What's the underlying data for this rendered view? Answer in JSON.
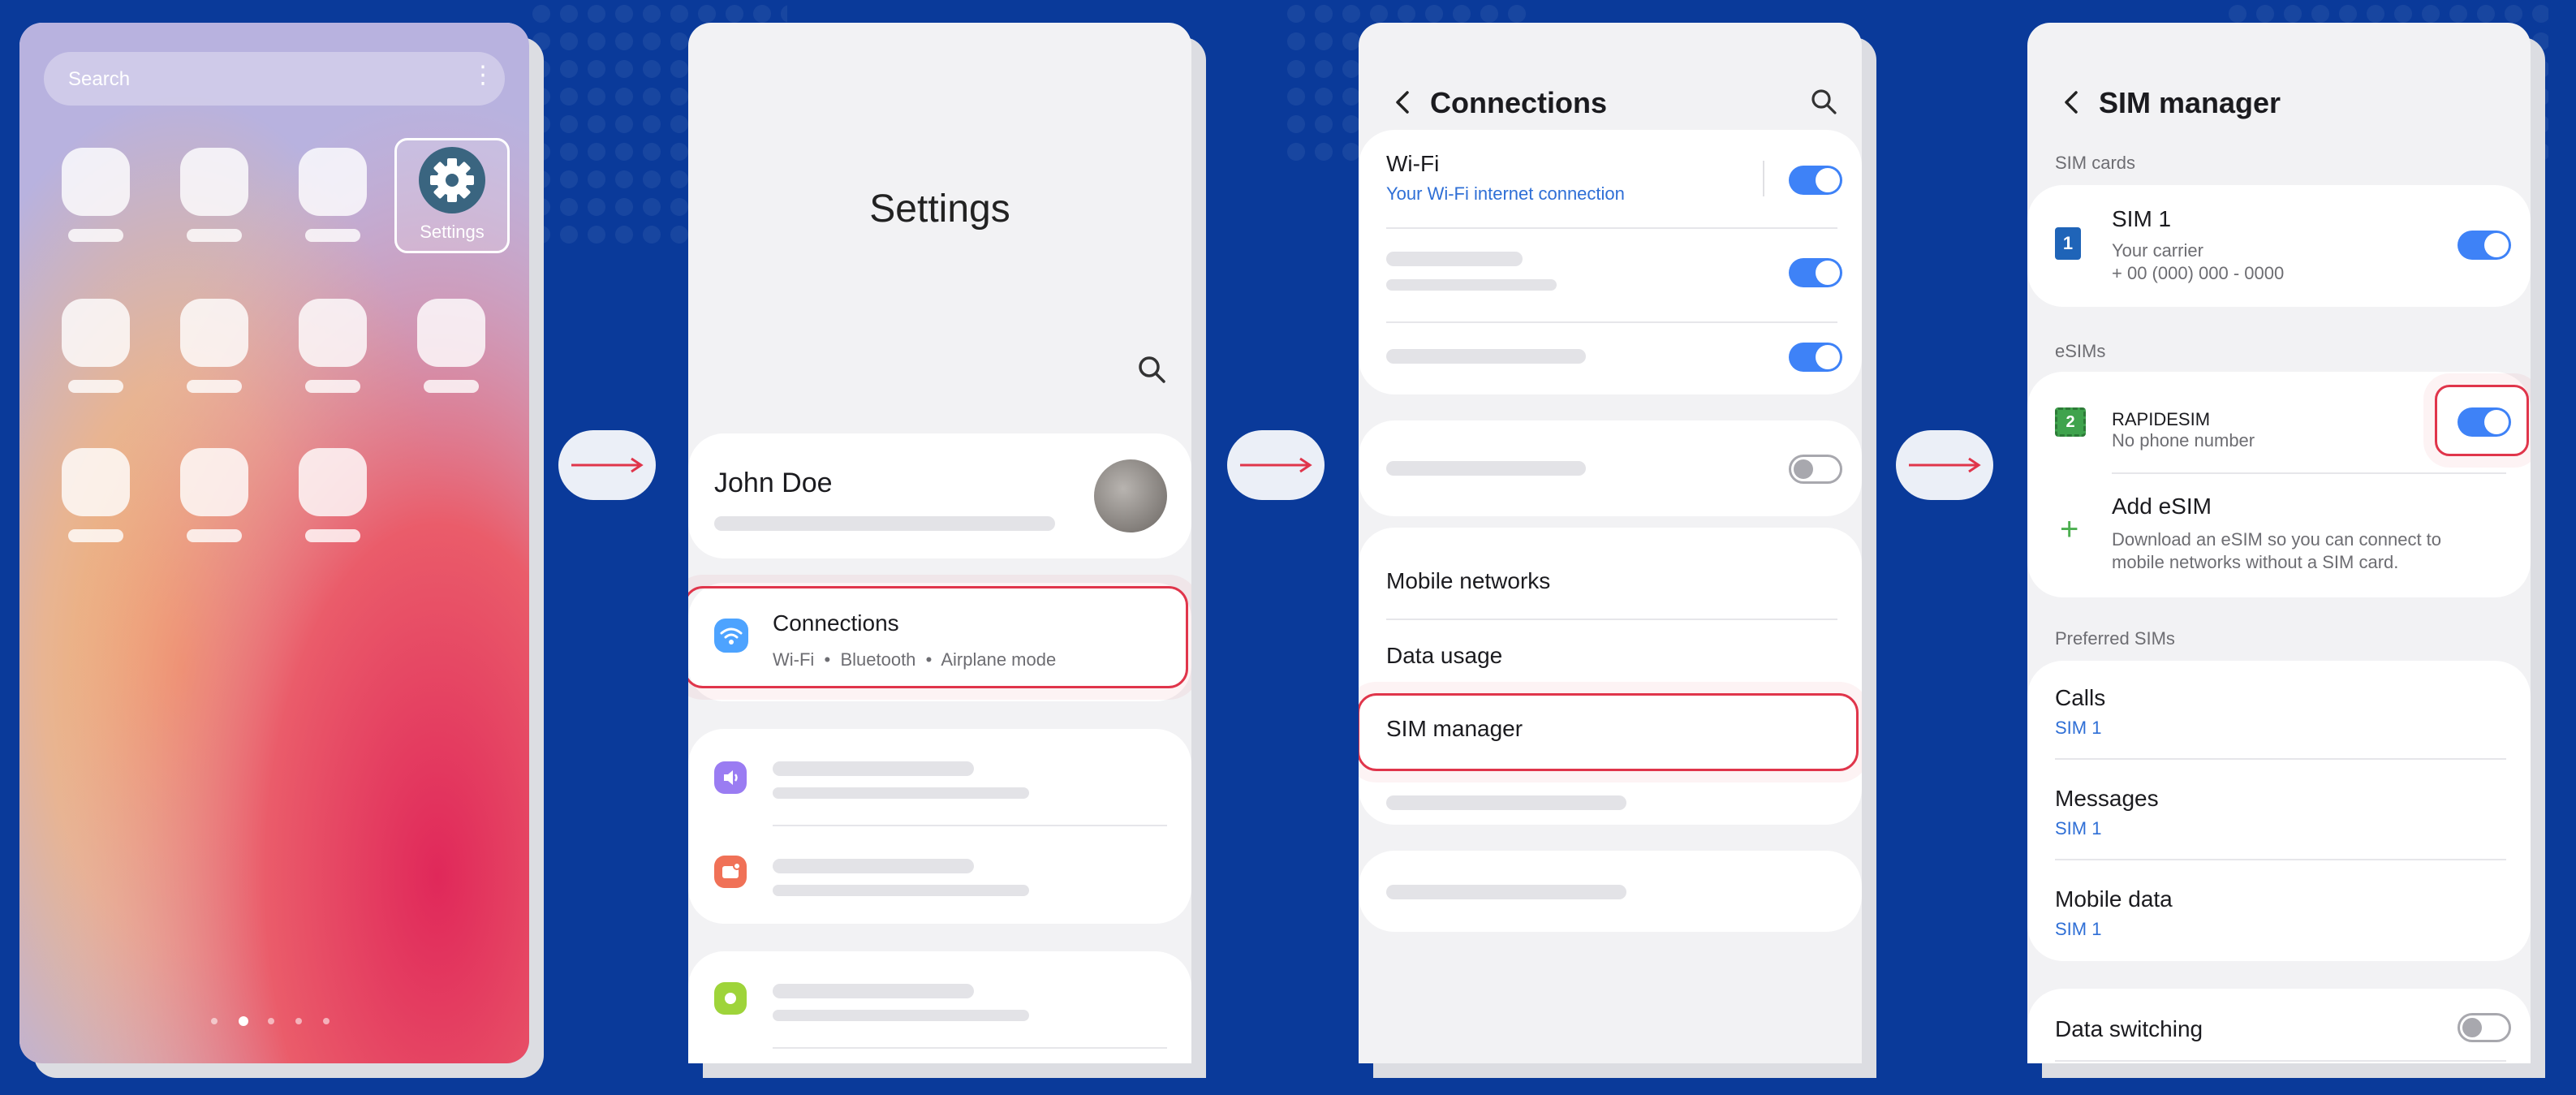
{
  "home": {
    "search_placeholder": "Search",
    "settings_label": "Settings"
  },
  "settings": {
    "title": "Settings",
    "profile_name": "John Doe",
    "connections_title": "Connections",
    "connections_sub": "Wi-Fi  •  Bluetooth  •  Airplane mode"
  },
  "connections": {
    "title": "Connections",
    "wifi_title": "Wi-Fi",
    "wifi_sub": "Your Wi-Fi internet connection",
    "mobile_networks": "Mobile networks",
    "data_usage": "Data usage",
    "sim_manager": "SIM manager"
  },
  "sim_manager": {
    "title": "SIM manager",
    "sim_cards_label": "SIM cards",
    "sim1_badge": "1",
    "sim1_title": "SIM 1",
    "sim1_carrier": "Your carrier",
    "sim1_number": "+ 00 (000) 000 - 0000",
    "esims_label": "eSIMs",
    "esim_badge": "2",
    "esim_name": "RAPIDESIM",
    "esim_sub": "No phone number",
    "add_esim_title": "Add eSIM",
    "add_esim_line1": "Download an eSIM so you can connect to",
    "add_esim_line2": "mobile networks without a SIM card.",
    "preferred_label": "Preferred SIMs",
    "calls_label": "Calls",
    "calls_value": "SIM 1",
    "messages_label": "Messages",
    "messages_value": "SIM 1",
    "mobile_data_label": "Mobile data",
    "mobile_data_value": "SIM 1",
    "data_switching_label": "Data switching"
  },
  "colors": {
    "background": "#0a3a9a",
    "accent_blue": "#3e82f7",
    "highlight_red": "#e0354b"
  }
}
